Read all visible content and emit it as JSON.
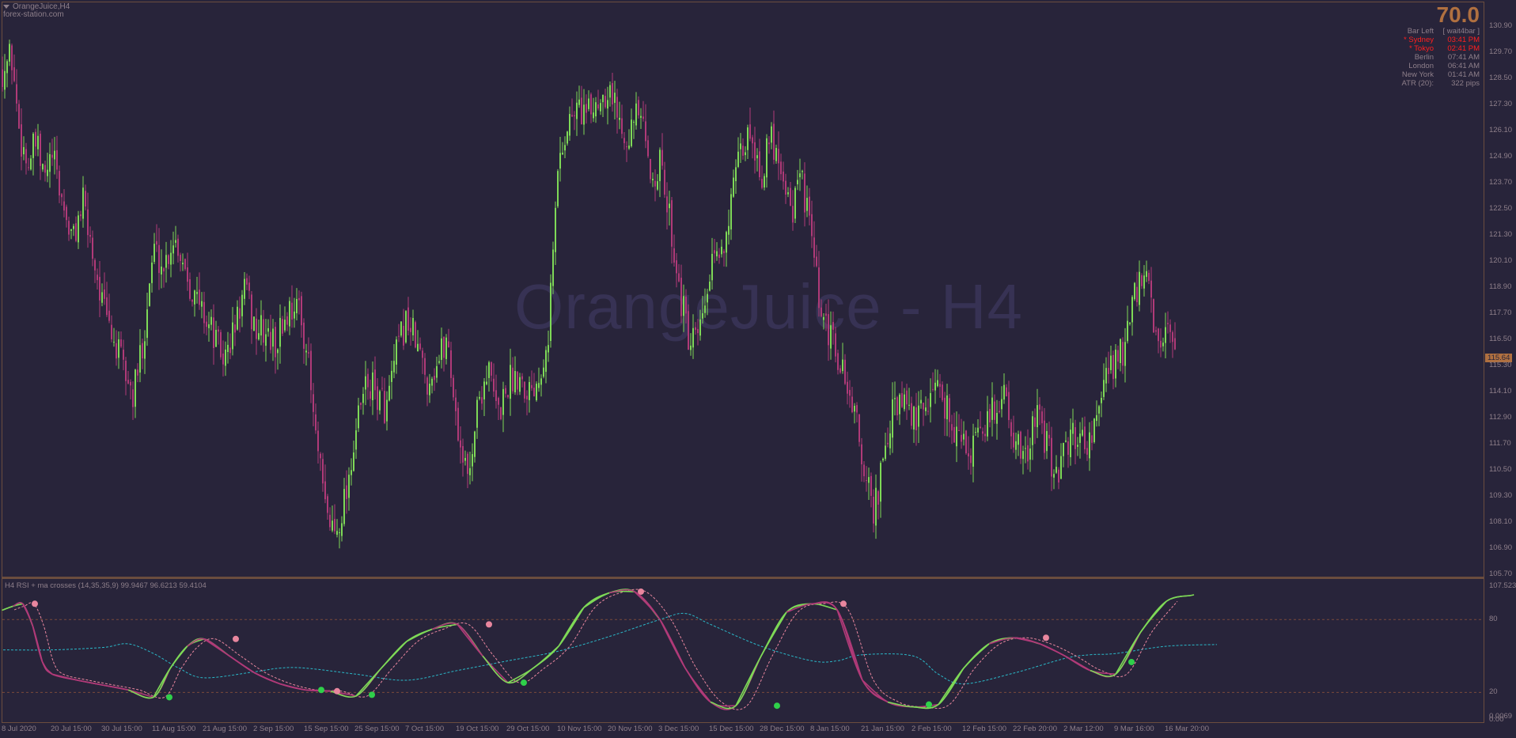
{
  "symbol_title": "OrangeJuice,H4",
  "site_text": "forex-station.com",
  "watermark": "OrangeJuice - H4",
  "info_panel": {
    "big_value": "70.0",
    "rows": [
      {
        "label": "Bar Left",
        "value": "[ wait4bar ]",
        "color": "#8e7f8a"
      },
      {
        "label": "* Sydney",
        "value": "03:41 PM",
        "color": "#ff2020"
      },
      {
        "label": "* Tokyo",
        "value": "02:41 PM",
        "color": "#ff2020"
      },
      {
        "label": "Berlin",
        "value": "07:41 AM",
        "color": "#8e7f8a"
      },
      {
        "label": "London",
        "value": "06:41 AM",
        "color": "#8e7f8a"
      },
      {
        "label": "New York",
        "value": "01:41 AM",
        "color": "#8e7f8a"
      },
      {
        "label": "ATR (20):",
        "value": "322 pips",
        "color": "#8e7f8a"
      }
    ]
  },
  "price_axis": [
    "130.90",
    "129.70",
    "128.50",
    "127.30",
    "126.10",
    "124.90",
    "123.70",
    "122.50",
    "121.30",
    "120.10",
    "118.90",
    "117.70",
    "116.50",
    "115.30",
    "114.10",
    "112.90",
    "111.70",
    "110.50",
    "109.30",
    "108.10",
    "106.90",
    "105.70"
  ],
  "current_price": "115.64",
  "indicator": {
    "title": "H4 RSI + ma crosses (14,35,35,9) 99.9467 96.6213 59.4104",
    "axis_labels": [
      "107.5232",
      "80",
      "20",
      "0.0069"
    ],
    "extra_axis_label": "0.00"
  },
  "time_axis": [
    "8 Jul 2020",
    "20 Jul 15:00",
    "30 Jul 15:00",
    "11 Aug 15:00",
    "21 Aug 15:00",
    "2 Sep 15:00",
    "15 Sep 15:00",
    "25 Sep 15:00",
    "7 Oct 15:00",
    "19 Oct 15:00",
    "29 Oct 15:00",
    "10 Nov 15:00",
    "20 Nov 15:00",
    "3 Dec 15:00",
    "15 Dec 15:00",
    "28 Dec 15:00",
    "8 Jan 15:00",
    "21 Jan 15:00",
    "2 Feb 15:00",
    "12 Feb 15:00",
    "22 Feb 20:00",
    "2 Mar 12:00",
    "9 Mar 16:00",
    "16 Mar 20:00"
  ],
  "colors": {
    "background": "#28243a",
    "bull_candle": "#7ed957",
    "bear_candle": "#b03a78",
    "rsi_line_up": "#7ed957",
    "rsi_line_down": "#b03a78",
    "signal_line": "#e8869e",
    "slow_ma": "#2ab8c8",
    "level_lines": "#7a4a3a",
    "cross_up_dot": "#2fd04a",
    "cross_down_dot": "#e8869e"
  },
  "chart_data": {
    "type": "candlestick",
    "title": "OrangeJuice,H4",
    "ylim": [
      105.7,
      130.9
    ],
    "close_path": [
      [
        "8 Jul 2020",
        128.9
      ],
      [
        "",
        129.6
      ],
      [
        "",
        126.0
      ],
      [
        "",
        124.5
      ],
      [
        "",
        125.5
      ],
      [
        "",
        123.8
      ],
      [
        "20 Jul 15:00",
        124.9
      ],
      [
        "",
        122.8
      ],
      [
        "",
        121.0
      ],
      [
        "",
        122.8
      ],
      [
        "",
        120.5
      ],
      [
        "30 Jul 15:00",
        118.0
      ],
      [
        "",
        116.5
      ],
      [
        "",
        115.2
      ],
      [
        "",
        113.8
      ],
      [
        "",
        116.6
      ],
      [
        "11 Aug 15:00",
        120.7
      ],
      [
        "",
        119.8
      ],
      [
        "",
        121.3
      ],
      [
        "",
        120.1
      ],
      [
        "",
        118.5
      ],
      [
        "21 Aug 15:00",
        117.7
      ],
      [
        "",
        116.6
      ],
      [
        "",
        115.5
      ],
      [
        "",
        117.0
      ],
      [
        "",
        118.8
      ],
      [
        "2 Sep 15:00",
        117.0
      ],
      [
        "",
        116.8
      ],
      [
        "",
        116.2
      ],
      [
        "",
        117.5
      ],
      [
        "",
        118.3
      ],
      [
        "15 Sep 15:00",
        116.6
      ],
      [
        "",
        112.0
      ],
      [
        "",
        108.5
      ],
      [
        "",
        107.6
      ],
      [
        "",
        109.5
      ],
      [
        "25 Sep 15:00",
        112.3
      ],
      [
        "",
        114.5
      ],
      [
        "",
        114.0
      ],
      [
        "",
        113.3
      ],
      [
        "",
        115.8
      ],
      [
        "7 Oct 15:00",
        117.5
      ],
      [
        "",
        116.2
      ],
      [
        "",
        114.6
      ],
      [
        "",
        115.4
      ],
      [
        "",
        116.6
      ],
      [
        "19 Oct 15:00",
        112.5
      ],
      [
        "",
        110.0
      ],
      [
        "",
        113.5
      ],
      [
        "",
        115.2
      ],
      [
        "",
        113.0
      ],
      [
        "29 Oct 15:00",
        114.5
      ],
      [
        "",
        115.0
      ],
      [
        "",
        114.2
      ],
      [
        "",
        114.8
      ],
      [
        "",
        117.0
      ],
      [
        "10 Nov 15:00",
        124.8
      ],
      [
        "",
        126.5
      ],
      [
        "",
        127.2
      ],
      [
        "",
        126.8
      ],
      [
        "",
        127.6
      ],
      [
        "20 Nov 15:00",
        128.2
      ],
      [
        "",
        126.5
      ],
      [
        "",
        126.0
      ],
      [
        "",
        127.0
      ],
      [
        "",
        124.0
      ],
      [
        "3 Dec 15:00",
        124.5
      ],
      [
        "",
        122.0
      ],
      [
        "",
        118.6
      ],
      [
        "",
        116.0
      ],
      [
        "",
        116.8
      ],
      [
        "15 Dec 15:00",
        119.5
      ],
      [
        "",
        120.5
      ],
      [
        "",
        122.6
      ],
      [
        "",
        125.0
      ],
      [
        "",
        126.2
      ],
      [
        "28 Dec 15:00",
        124.0
      ],
      [
        "",
        125.8
      ],
      [
        "",
        124.6
      ],
      [
        "",
        122.4
      ],
      [
        "",
        124.0
      ],
      [
        "8 Jan 15:00",
        121.0
      ],
      [
        "",
        117.0
      ],
      [
        "",
        116.5
      ],
      [
        "",
        115.0
      ],
      [
        "",
        113.6
      ],
      [
        "21 Jan 15:00",
        111.0
      ],
      [
        "",
        108.5
      ],
      [
        "",
        110.5
      ],
      [
        "",
        113.2
      ],
      [
        "",
        113.5
      ],
      [
        "2 Feb 15:00",
        112.8
      ],
      [
        "",
        113.0
      ],
      [
        "",
        114.6
      ],
      [
        "",
        113.8
      ],
      [
        "",
        112.5
      ],
      [
        "12 Feb 15:00",
        111.6
      ],
      [
        "",
        111.4
      ],
      [
        "",
        112.5
      ],
      [
        "",
        113.3
      ],
      [
        "",
        114.1
      ],
      [
        "22 Feb 20:00",
        112.0
      ],
      [
        "",
        110.6
      ],
      [
        "",
        113.2
      ],
      [
        "",
        111.8
      ],
      [
        "",
        110.4
      ],
      [
        "2 Mar 12:00",
        111.2
      ],
      [
        "",
        112.2
      ],
      [
        "",
        111.8
      ],
      [
        "",
        112.5
      ],
      [
        "",
        114.6
      ],
      [
        "9 Mar 16:00",
        115.6
      ],
      [
        "",
        116.2
      ],
      [
        "",
        118.6
      ],
      [
        "",
        119.4
      ],
      [
        "",
        116.4
      ],
      [
        "16 Mar 20:00",
        116.7
      ],
      [
        "",
        115.64
      ]
    ],
    "indicator": {
      "name": "H4 RSI + ma crosses (14,35,35,9)",
      "ylim": [
        0.0069,
        107.5232
      ],
      "levels": [
        80,
        20
      ],
      "values": {
        "rsi": 99.9467,
        "signal": 96.6213,
        "slow": 59.4104
      },
      "rsi_path": [
        [
          "8 Jul 2020",
          88
        ],
        [
          "",
          91
        ],
        [
          "",
          93
        ],
        [
          "",
          75
        ],
        [
          "",
          45
        ],
        [
          "20 Jul 15:00",
          35
        ],
        [
          "",
          30
        ],
        [
          "30 Jul 15:00",
          26
        ],
        [
          "",
          22
        ],
        [
          "11 Aug 15:00",
          16
        ],
        [
          "",
          40
        ],
        [
          "",
          58
        ],
        [
          "21 Aug 15:00",
          64
        ],
        [
          "",
          50
        ],
        [
          "2 Sep 15:00",
          36
        ],
        [
          "",
          27
        ],
        [
          "15 Sep 15:00",
          22
        ],
        [
          "",
          21
        ],
        [
          "25 Sep 15:00",
          17
        ],
        [
          "",
          40
        ],
        [
          "7 Oct 15:00",
          62
        ],
        [
          "",
          72
        ],
        [
          "19 Oct 15:00",
          76
        ],
        [
          "",
          50
        ],
        [
          "29 Oct 15:00",
          28
        ],
        [
          "",
          40
        ],
        [
          "10 Nov 15:00",
          58
        ],
        [
          "",
          90
        ],
        [
          "20 Nov 15:00",
          102
        ],
        [
          "",
          103
        ],
        [
          "3 Dec 15:00",
          80
        ],
        [
          "",
          40
        ],
        [
          "15 Dec 15:00",
          12
        ],
        [
          "",
          9
        ],
        [
          "28 Dec 15:00",
          50
        ],
        [
          "",
          86
        ],
        [
          "8 Jan 15:00",
          93
        ],
        [
          "",
          88
        ],
        [
          "21 Jan 15:00",
          30
        ],
        [
          "",
          12
        ],
        [
          "2 Feb 15:00",
          8
        ],
        [
          "",
          10
        ],
        [
          "12 Feb 15:00",
          40
        ],
        [
          "",
          60
        ],
        [
          "22 Feb 20:00",
          65
        ],
        [
          "",
          60
        ],
        [
          "2 Mar 12:00",
          50
        ],
        [
          "",
          38
        ],
        [
          "9 Mar 16:00",
          35
        ],
        [
          "",
          70
        ],
        [
          "16 Mar 20:00",
          95
        ],
        [
          "",
          99.9467
        ]
      ],
      "slow_path": [
        [
          "8 Jul 2020",
          55
        ],
        [
          "20 Jul 15:00",
          55
        ],
        [
          "30 Jul 15:00",
          57
        ],
        [
          "",
          60
        ],
        [
          "11 Aug 15:00",
          52
        ],
        [
          "",
          40
        ],
        [
          "21 Aug 15:00",
          32
        ],
        [
          "2 Sep 15:00",
          37
        ],
        [
          "",
          40
        ],
        [
          "15 Sep 15:00",
          40
        ],
        [
          "25 Sep 15:00",
          35
        ],
        [
          "7 Oct 15:00",
          30
        ],
        [
          "19 Oct 15:00",
          38
        ],
        [
          "29 Oct 15:00",
          46
        ],
        [
          "10 Nov 15:00",
          54
        ],
        [
          "20 Nov 15:00",
          66
        ],
        [
          "3 Dec 15:00",
          80
        ],
        [
          "",
          85
        ],
        [
          "15 Dec 15:00",
          76
        ],
        [
          "28 Dec 15:00",
          58
        ],
        [
          "8 Jan 15:00",
          46
        ],
        [
          "",
          46
        ],
        [
          "21 Jan 15:00",
          51
        ],
        [
          "2 Feb 15:00",
          50
        ],
        [
          "",
          35
        ],
        [
          "12 Feb 15:00",
          27
        ],
        [
          "22 Feb 20:00",
          36
        ],
        [
          "2 Mar 12:00",
          48
        ],
        [
          "",
          51
        ],
        [
          "9 Mar 16:00",
          52
        ],
        [
          "16 Mar 20:00",
          58
        ],
        [
          "",
          59.4104
        ]
      ],
      "cross_down": [
        [
          "8 Jul 2020",
          93
        ],
        [
          "21 Aug 15:00",
          64
        ],
        [
          "15 Sep 15:00",
          21
        ],
        [
          "19 Oct 15:00",
          76
        ],
        [
          "20 Nov 15:00",
          103
        ],
        [
          "8 Jan 15:00",
          93
        ],
        [
          "22 Feb 20:00",
          65
        ]
      ],
      "cross_up": [
        [
          "11 Aug 15:00",
          16
        ],
        [
          "15 Sep 15:00",
          22
        ],
        [
          "25 Sep 15:00",
          18
        ],
        [
          "29 Oct 15:00",
          28
        ],
        [
          "28 Dec 15:00",
          9
        ],
        [
          "2 Feb 15:00",
          10
        ],
        [
          "9 Mar 16:00",
          45
        ]
      ]
    }
  }
}
